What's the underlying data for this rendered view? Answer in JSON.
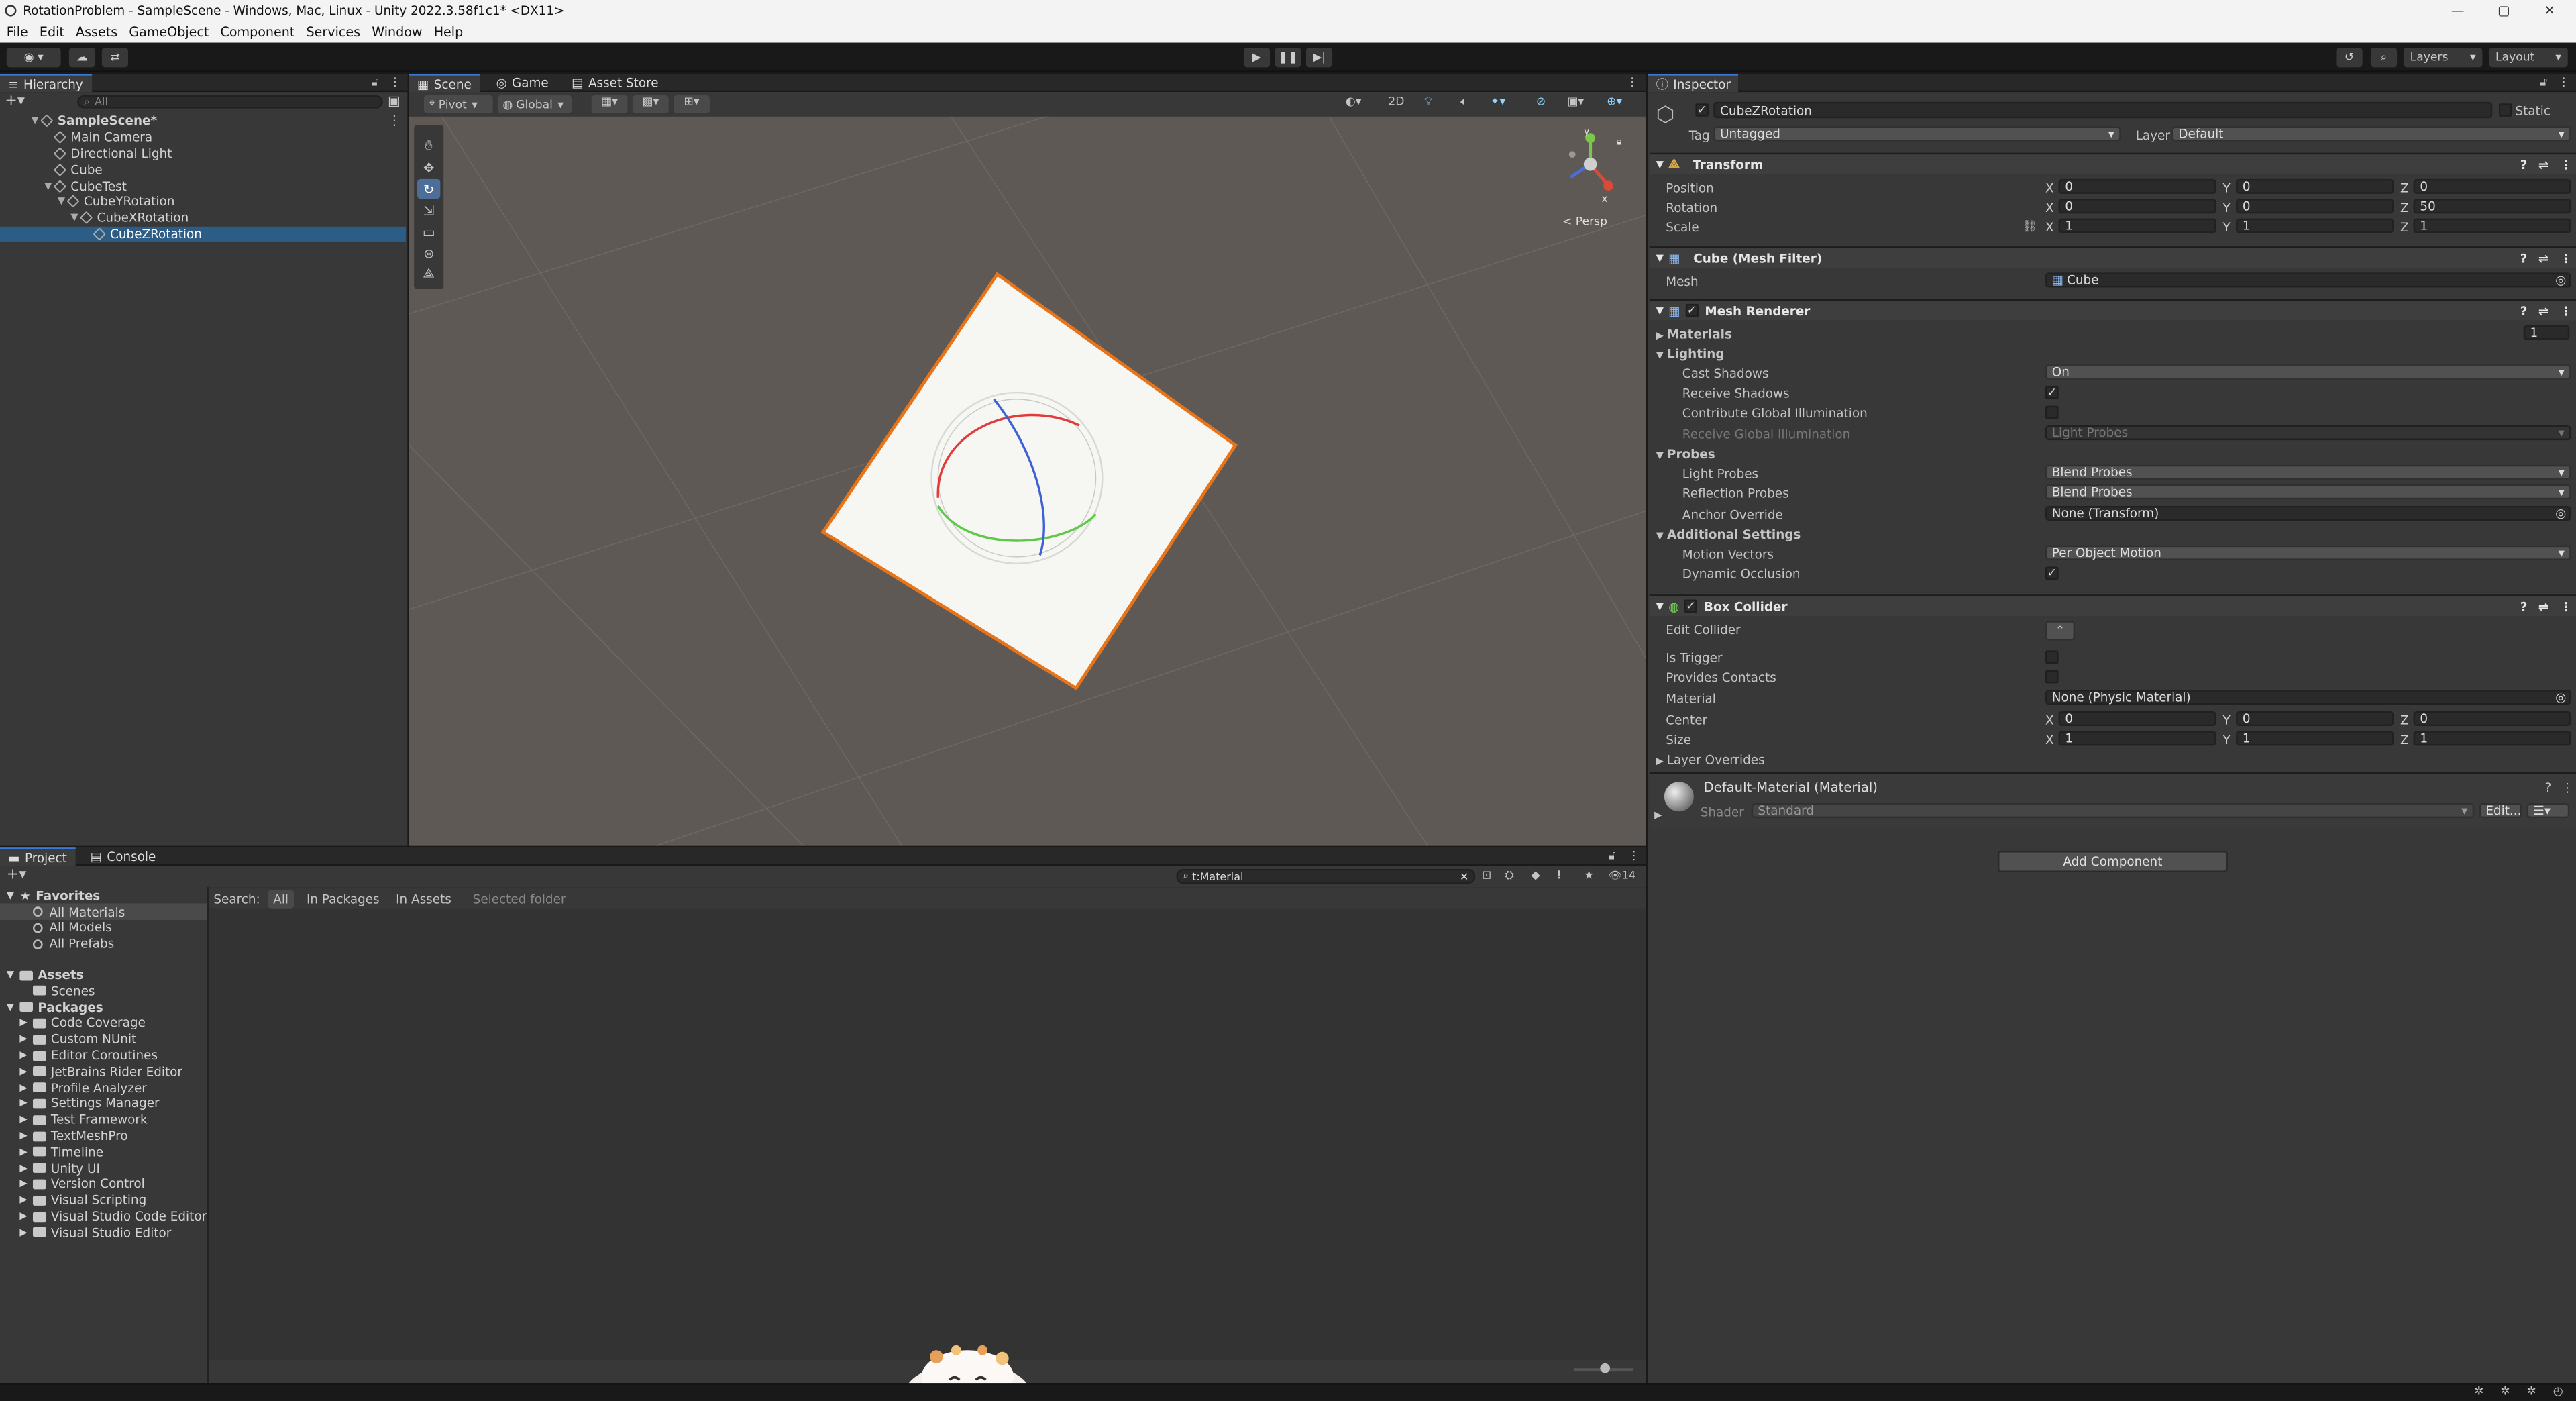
{
  "window": {
    "title": "RotationProblem - SampleScene - Windows, Mac, Linux - Unity 2022.3.58f1c1* <DX11>",
    "min": "—",
    "max": "▢",
    "close": "✕"
  },
  "menu": [
    "File",
    "Edit",
    "Assets",
    "GameObject",
    "Component",
    "Services",
    "Window",
    "Help"
  ],
  "toolbar": {
    "layers": "Layers",
    "layout": "Layout"
  },
  "hierarchy": {
    "tab": "Hierarchy",
    "search_placeholder": "All",
    "items": [
      {
        "label": "SampleScene*",
        "depth": 0,
        "fold": "▼"
      },
      {
        "label": "Main Camera",
        "depth": 1,
        "fold": ""
      },
      {
        "label": "Directional Light",
        "depth": 1,
        "fold": ""
      },
      {
        "label": "Cube",
        "depth": 1,
        "fold": ""
      },
      {
        "label": "CubeTest",
        "depth": 1,
        "fold": "▼"
      },
      {
        "label": "CubeYRotation",
        "depth": 2,
        "fold": "▼"
      },
      {
        "label": "CubeXRotation",
        "depth": 3,
        "fold": "▼"
      },
      {
        "label": "CubeZRotation",
        "depth": 4,
        "fold": "",
        "selected": true
      }
    ]
  },
  "scene": {
    "tabs": [
      "Scene",
      "Game",
      "Asset Store"
    ],
    "pivot": "Pivot",
    "global": "Global",
    "mode2d": "2D",
    "persp": "< Persp",
    "gizmo_y": "y",
    "gizmo_x": "x"
  },
  "inspector": {
    "tab": "Inspector",
    "object_name": "CubeZRotation",
    "static": "Static",
    "tag_label": "Tag",
    "tag": "Untagged",
    "layer_label": "Layer",
    "layer": "Default",
    "transform": {
      "title": "Transform",
      "position_label": "Position",
      "rotation_label": "Rotation",
      "scale_label": "Scale",
      "position": {
        "x": "0",
        "y": "0",
        "z": "0"
      },
      "rotation": {
        "x": "0",
        "y": "0",
        "z": "50"
      },
      "scale": {
        "x": "1",
        "y": "1",
        "z": "1"
      }
    },
    "mesh_filter": {
      "title": "Cube (Mesh Filter)",
      "mesh_label": "Mesh",
      "mesh": "Cube"
    },
    "mesh_renderer": {
      "title": "Mesh Renderer",
      "materials": "Materials",
      "materials_count": "1",
      "lighting": "Lighting",
      "cast_shadows": "Cast Shadows",
      "cast_shadows_value": "On",
      "receive_shadows": "Receive Shadows",
      "contribute_gi": "Contribute Global Illumination",
      "receive_gi": "Receive Global Illumination",
      "receive_gi_value": "Light Probes",
      "probes": "Probes",
      "light_probes": "Light Probes",
      "light_probes_value": "Blend Probes",
      "reflection_probes": "Reflection Probes",
      "reflection_probes_value": "Blend Probes",
      "anchor_override": "Anchor Override",
      "anchor_override_value": "None (Transform)",
      "additional": "Additional Settings",
      "motion_vectors": "Motion Vectors",
      "motion_vectors_value": "Per Object Motion",
      "dynamic_occlusion": "Dynamic Occlusion"
    },
    "box_collider": {
      "title": "Box Collider",
      "edit_collider": "Edit Collider",
      "is_trigger": "Is Trigger",
      "provides_contacts": "Provides Contacts",
      "material_label": "Material",
      "material": "None (Physic Material)",
      "center_label": "Center",
      "size_label": "Size",
      "center": {
        "x": "0",
        "y": "0",
        "z": "0"
      },
      "size": {
        "x": "1",
        "y": "1",
        "z": "1"
      },
      "layer_overrides": "Layer Overrides"
    },
    "material": {
      "title": "Default-Material (Material)",
      "shader_label": "Shader",
      "shader": "Standard",
      "edit": "Edit..."
    },
    "add_component": "Add Component",
    "axis": {
      "x": "X",
      "y": "Y",
      "z": "Z"
    }
  },
  "project": {
    "tabs": [
      "Project",
      "Console"
    ],
    "search_value": "t:Material",
    "count": "14",
    "search_label": "Search:",
    "filters": [
      "All",
      "In Packages",
      "In Assets",
      "Selected folder"
    ],
    "favorites": "Favorites",
    "fav_items": [
      "All Materials",
      "All Models",
      "All Prefabs"
    ],
    "assets": "Assets",
    "asset_items": [
      "Scenes"
    ],
    "packages": "Packages",
    "package_items": [
      "Code Coverage",
      "Custom NUnit",
      "Editor Coroutines",
      "JetBrains Rider Editor",
      "Profile Analyzer",
      "Settings Manager",
      "Test Framework",
      "TextMeshPro",
      "Timeline",
      "Unity UI",
      "Version Control",
      "Visual Scripting",
      "Visual Studio Code Editor",
      "Visual Studio Editor"
    ]
  }
}
